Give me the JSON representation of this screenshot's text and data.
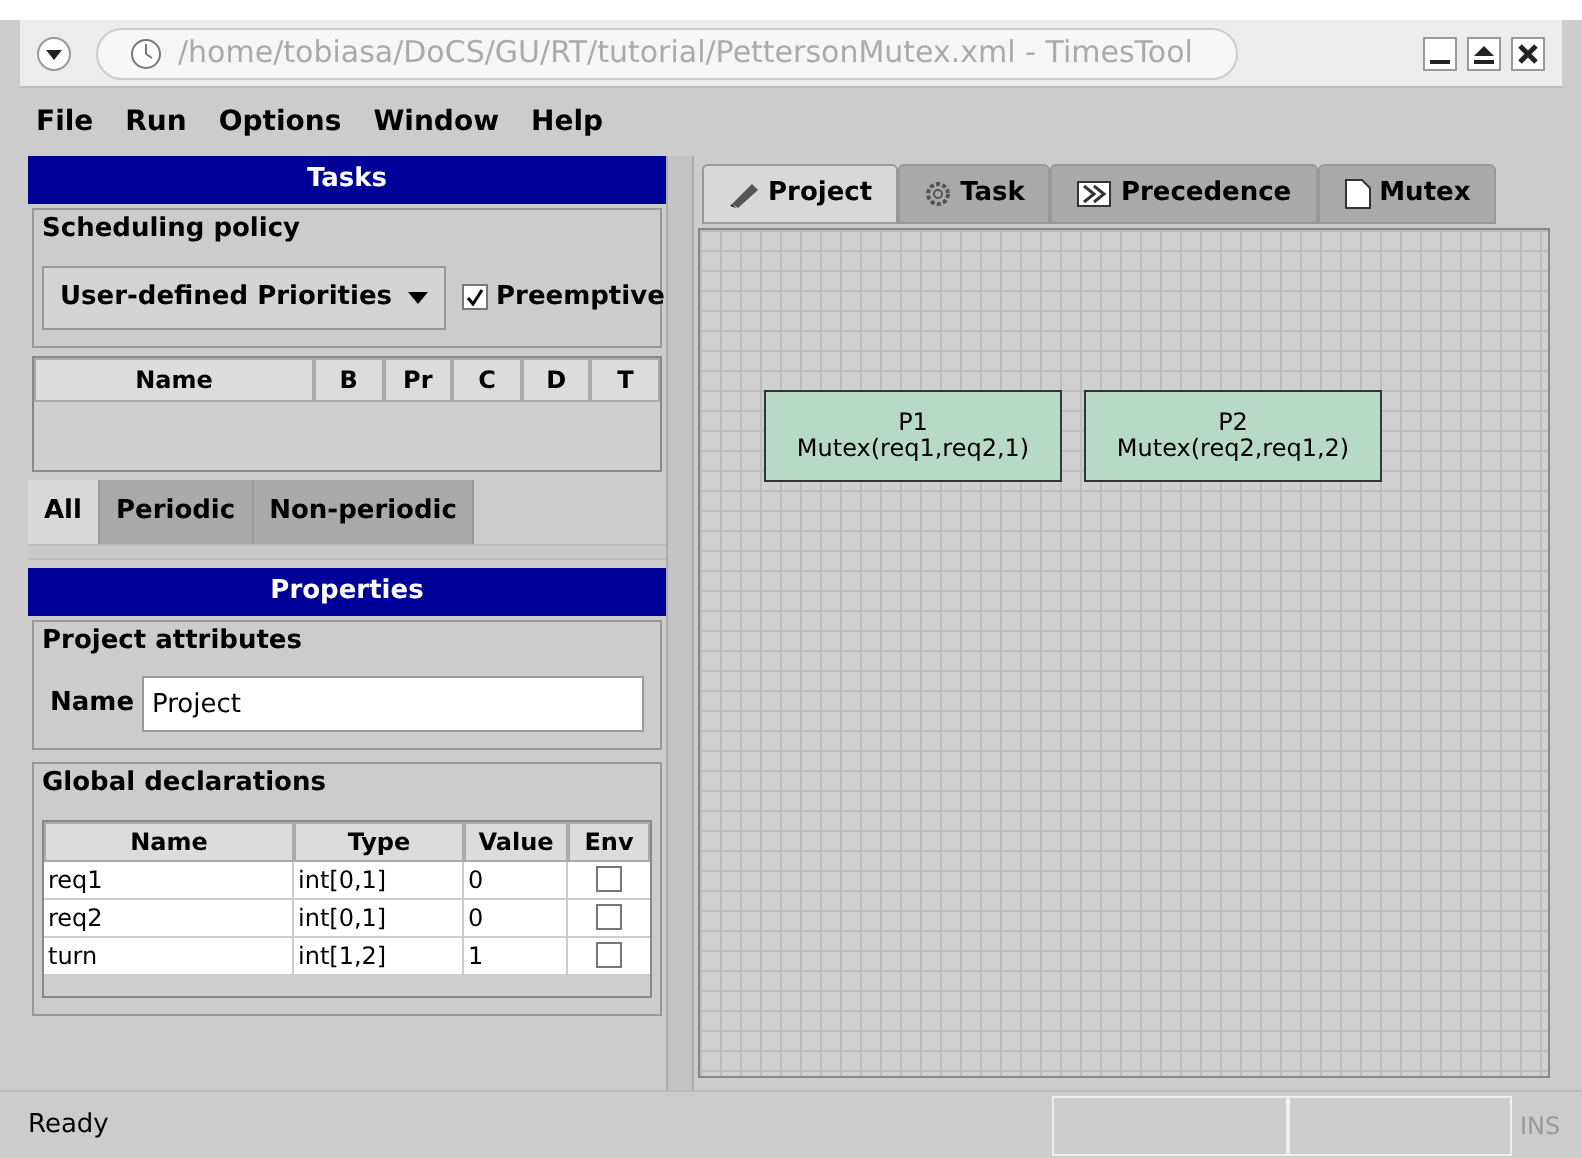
{
  "window": {
    "title": "/home/tobiasa/DoCS/GU/RT/tutorial/PettersonMutex.xml - TimesTool"
  },
  "menu": [
    "File",
    "Run",
    "Options",
    "Window",
    "Help"
  ],
  "tasks_panel": {
    "title": "Tasks",
    "policy_group": "Scheduling policy",
    "policy": "User-defined Priorities",
    "preemptive": {
      "label": "Preemptive",
      "checked": true
    },
    "columns": [
      "Name",
      "B",
      "Pr",
      "C",
      "D",
      "T"
    ],
    "tabs": [
      {
        "label": "All",
        "selected": true
      },
      {
        "label": "Periodic",
        "selected": false
      },
      {
        "label": "Non-periodic",
        "selected": false
      }
    ]
  },
  "properties_panel": {
    "title": "Properties",
    "attributes_group": "Project attributes",
    "name_label": "Name",
    "name_value": "Project",
    "declarations_group": "Global declarations",
    "columns": [
      "Name",
      "Type",
      "Value",
      "Env"
    ],
    "rows": [
      {
        "name": "req1",
        "type": "int[0,1]",
        "value": "0",
        "env": false
      },
      {
        "name": "req2",
        "type": "int[0,1]",
        "value": "0",
        "env": false
      },
      {
        "name": "turn",
        "type": "int[1,2]",
        "value": "1",
        "env": false
      }
    ]
  },
  "editor_tabs": [
    {
      "label": "Project",
      "kind": "project",
      "selected": true
    },
    {
      "label": "Task",
      "kind": "task",
      "selected": false
    },
    {
      "label": "Precedence",
      "kind": "precedence",
      "selected": false
    },
    {
      "label": "Mutex",
      "kind": "mutex",
      "selected": false
    }
  ],
  "nodes": [
    {
      "name": "P1",
      "label": "Mutex(req1,req2,1)"
    },
    {
      "name": "P2",
      "label": "Mutex(req2,req1,2)"
    }
  ],
  "status_bar": {
    "message": "Ready",
    "mode": {
      "label": "INS",
      "disabled": true
    }
  }
}
